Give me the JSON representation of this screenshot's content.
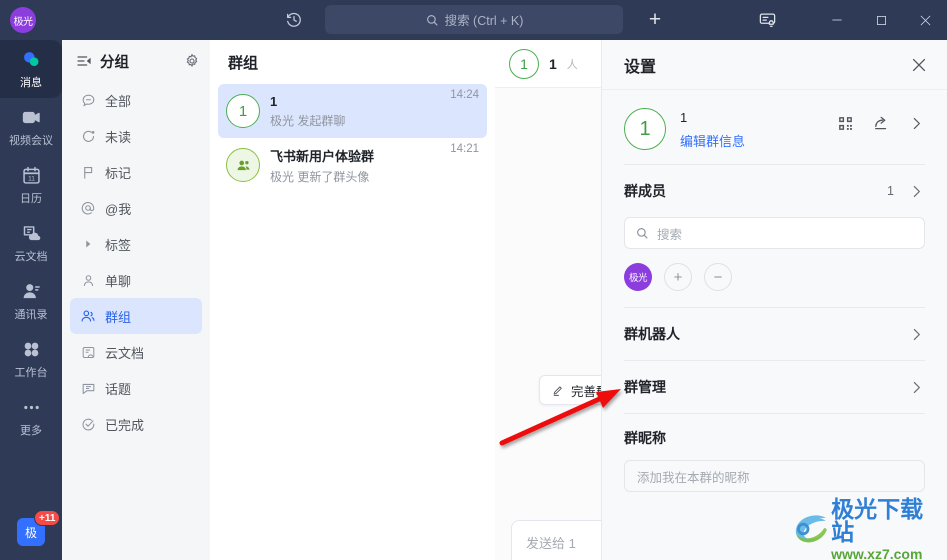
{
  "titlebar": {
    "brand_avatar": "极光",
    "history_icon": "history-icon",
    "search_placeholder": "搜索 (Ctrl + K)",
    "plus_label": "+",
    "notice_icon": "notification-board-icon",
    "minimize": "—",
    "maximize": "□",
    "close": "✕"
  },
  "rail": {
    "items": [
      {
        "label": "消息",
        "icon": "message-icon",
        "active": true
      },
      {
        "label": "视频会议",
        "icon": "video-meeting-icon",
        "active": false
      },
      {
        "label": "日历",
        "icon": "calendar-icon",
        "active": false
      },
      {
        "label": "云文档",
        "icon": "cloud-doc-icon",
        "active": false
      },
      {
        "label": "通讯录",
        "icon": "contacts-icon",
        "active": false
      },
      {
        "label": "工作台",
        "icon": "workspace-icon",
        "active": false
      },
      {
        "label": "更多",
        "icon": "more-dots-icon",
        "active": false
      }
    ],
    "user_avatar": "极",
    "badge": "+11"
  },
  "navcol": {
    "title": "分组",
    "settings_icon": "gear-icon",
    "collapse_icon": "collapse-list-icon",
    "items": [
      {
        "label": "全部",
        "icon": "all-icon",
        "active": false
      },
      {
        "label": "未读",
        "icon": "unread-icon",
        "active": false
      },
      {
        "label": "标记",
        "icon": "flag-icon",
        "active": false
      },
      {
        "label": "@我",
        "icon": "at-me-icon",
        "active": false
      },
      {
        "label": "标签",
        "icon": "triangle-right-icon",
        "active": false
      },
      {
        "label": "单聊",
        "icon": "single-chat-icon",
        "active": false
      },
      {
        "label": "群组",
        "icon": "group-icon",
        "active": true
      },
      {
        "label": "云文档",
        "icon": "cloud-doc-icon",
        "active": false
      },
      {
        "label": "话题",
        "icon": "topic-icon",
        "active": false
      },
      {
        "label": "已完成",
        "icon": "done-check-icon",
        "active": false
      }
    ]
  },
  "chatlist": {
    "title": "群组",
    "rows": [
      {
        "avatar": "1",
        "avatar_kind": "ring",
        "name": "1",
        "subtitle": "极光 发起群聊",
        "time": "14:24",
        "active": true
      },
      {
        "avatar": "people-icon",
        "avatar_kind": "greenfill",
        "name": "飞书新用户体验群",
        "subtitle": "极光 更新了群头像",
        "time": "14:21",
        "active": false
      }
    ]
  },
  "conversation": {
    "avatar": "1",
    "name": "1",
    "member_hint": "人",
    "improve_chip": "完善群",
    "improve_icon": "pencil-icon",
    "composer_placeholder": "发送给 1"
  },
  "settings": {
    "title": "设置",
    "close_icon": "close-icon",
    "group": {
      "avatar": "1",
      "name": "1",
      "edit_link": "编辑群信息",
      "qr_icon": "qr-code-icon",
      "share_icon": "share-icon",
      "chevron_icon": "chevron-right-icon"
    },
    "members": {
      "title": "群成员",
      "count": "1",
      "chevron_icon": "chevron-right-icon",
      "search_placeholder": "搜索",
      "search_icon": "search-icon",
      "avatars": [
        {
          "label": "极光",
          "color": "#8b3dde"
        }
      ],
      "add_label": "+",
      "remove_label": "−"
    },
    "rows": [
      {
        "title": "群机器人",
        "chevron_icon": "chevron-right-icon"
      },
      {
        "title": "群管理",
        "chevron_icon": "chevron-right-icon"
      }
    ],
    "nickname": {
      "label": "群昵称",
      "placeholder": "添加我在本群的昵称"
    }
  },
  "annotation": {
    "arrow_color": "#ee1111",
    "arrow_name": "red-pointer-arrow"
  },
  "watermark": {
    "title": "极光下载站",
    "url": "www.xz7.com"
  }
}
